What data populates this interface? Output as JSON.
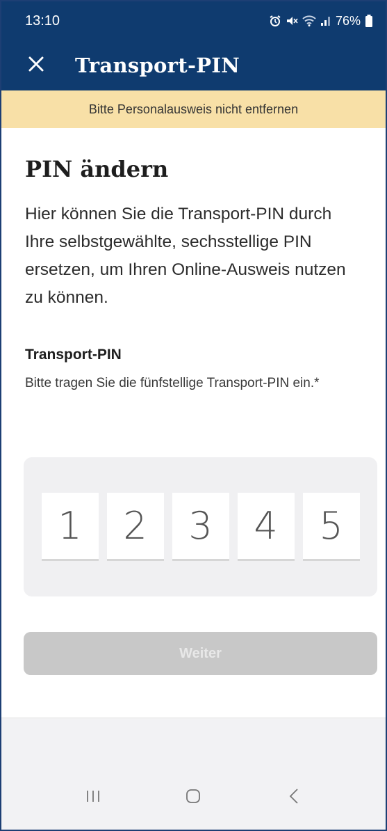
{
  "status_bar": {
    "time": "13:10",
    "battery": "76%",
    "icons": [
      "alarm-icon",
      "mute-icon",
      "wifi-icon",
      "signal-icon",
      "battery-icon"
    ]
  },
  "app_bar": {
    "title": "Transport-PIN",
    "close_icon": "close-icon",
    "color": "#0f3b6f"
  },
  "banner": {
    "text": "Bitte Personalausweis nicht entfernen",
    "color": "#f8e0a7"
  },
  "main": {
    "heading": "PIN ändern",
    "intro": "Hier können Sie die Transport-PIN durch Ihre selbstgewählte, sechsstellige PIN ersetzen, um Ihren Online-Ausweis nutzen zu können.",
    "field_label": "Transport-PIN",
    "field_hint": "Bitte tragen Sie die fünfstellige Transport-PIN ein.*",
    "pin_digits": [
      "1",
      "2",
      "3",
      "4",
      "5"
    ],
    "button_label": "Weiter"
  },
  "nav_bar": {
    "icons": [
      "recents-icon",
      "home-icon",
      "back-icon"
    ]
  }
}
